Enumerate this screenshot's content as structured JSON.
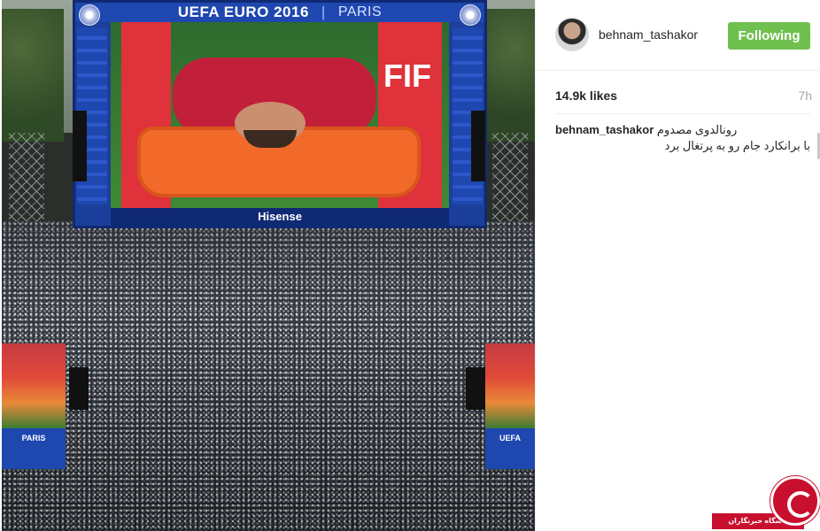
{
  "photo": {
    "screen_title": "UEFA EURO 2016",
    "screen_city": "PARIS",
    "screen_sponsor": "Hisense",
    "small_screen_label": "PARIS",
    "small_screen_label_right": "UEFA",
    "player_jersey_text": "FIF",
    "watermark_text": "باشگاه خبرنگاران"
  },
  "header": {
    "username": "behnam_tashakor",
    "follow_label": "Following"
  },
  "meta": {
    "likes": "14.9k likes",
    "time": "7h"
  },
  "caption": {
    "user": "behnam_tashakor",
    "line1": "رونالدوی مصدوم",
    "line2": "با برانکارد جام رو به پرتغال برد"
  },
  "colors": {
    "follow_green": "#70c050",
    "text_dark": "#262626",
    "text_muted": "#a5a7aa",
    "screen_blue": "#1f47b0"
  }
}
